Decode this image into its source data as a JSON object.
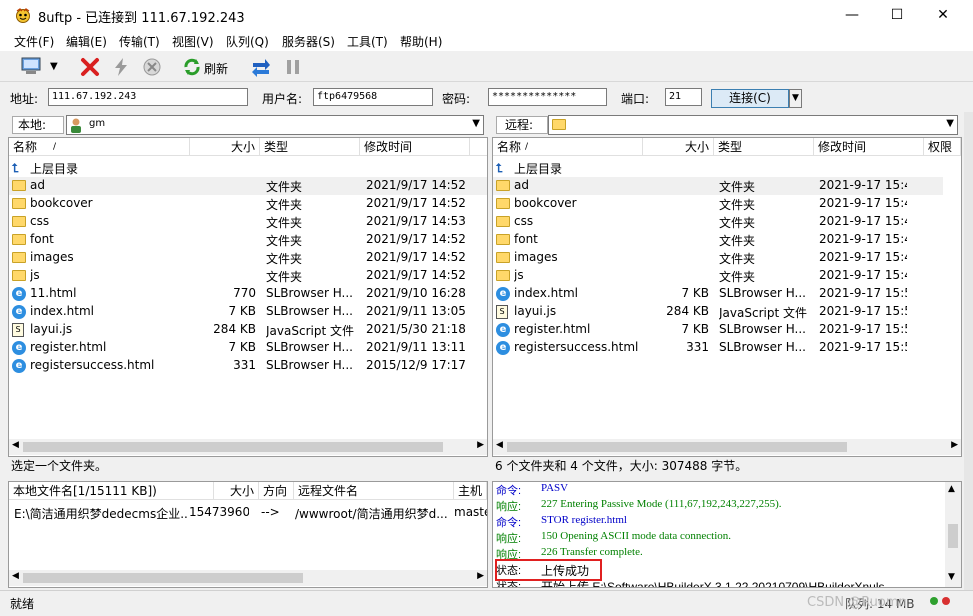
{
  "window": {
    "title": "8uftp - 已连接到 111.67.192.243",
    "minimize": "—",
    "maximize": "☐",
    "close": "✕"
  },
  "menu": [
    "文件(F)",
    "编辑(E)",
    "传输(T)",
    "视图(V)",
    "队列(Q)",
    "服务器(S)",
    "工具(T)",
    "帮助(H)"
  ],
  "toolbar": {
    "refresh_label": "刷新"
  },
  "connection": {
    "address_label": "地址:",
    "address_value": "111.67.192.243",
    "username_label": "用户名:",
    "username_value": "ftp6479568",
    "password_label": "密码:",
    "password_value": "**************",
    "port_label": "端口:",
    "port_value": "21",
    "connect_label": "连接(C)"
  },
  "local": {
    "path_label": "本地:",
    "path_value": "gm",
    "columns": [
      "名称",
      "大小",
      "类型",
      "修改时间"
    ],
    "parent_label": "上层目录",
    "files": [
      {
        "name": "ad",
        "size": "",
        "type": "文件夹",
        "mtime": "2021/9/17 14:52",
        "icon": "folder"
      },
      {
        "name": "bookcover",
        "size": "",
        "type": "文件夹",
        "mtime": "2021/9/17 14:52",
        "icon": "folder"
      },
      {
        "name": "css",
        "size": "",
        "type": "文件夹",
        "mtime": "2021/9/17 14:53",
        "icon": "folder"
      },
      {
        "name": "font",
        "size": "",
        "type": "文件夹",
        "mtime": "2021/9/17 14:52",
        "icon": "folder"
      },
      {
        "name": "images",
        "size": "",
        "type": "文件夹",
        "mtime": "2021/9/17 14:52",
        "icon": "folder"
      },
      {
        "name": "js",
        "size": "",
        "type": "文件夹",
        "mtime": "2021/9/17 14:52",
        "icon": "folder"
      },
      {
        "name": "11.html",
        "size": "770",
        "type": "SLBrowser H...",
        "mtime": "2021/9/10 16:28",
        "icon": "html"
      },
      {
        "name": "index.html",
        "size": "7 KB",
        "type": "SLBrowser H...",
        "mtime": "2021/9/11 13:05",
        "icon": "html"
      },
      {
        "name": "layui.js",
        "size": "284 KB",
        "type": "JavaScript 文件",
        "mtime": "2021/5/30 21:18",
        "icon": "js"
      },
      {
        "name": "register.html",
        "size": "7 KB",
        "type": "SLBrowser H...",
        "mtime": "2021/9/11 13:11",
        "icon": "html"
      },
      {
        "name": "registersuccess.html",
        "size": "331",
        "type": "SLBrowser H...",
        "mtime": "2015/12/9 17:17",
        "icon": "html"
      }
    ],
    "status": "选定一个文件夹。"
  },
  "remote": {
    "path_label": "远程:",
    "columns": [
      "名称",
      "大小",
      "类型",
      "修改时间",
      "权限"
    ],
    "parent_label": "上层目录",
    "files": [
      {
        "name": "ad",
        "size": "",
        "type": "文件夹",
        "mtime": "2021-9-17 15:4",
        "icon": "folder"
      },
      {
        "name": "bookcover",
        "size": "",
        "type": "文件夹",
        "mtime": "2021-9-17 15:4",
        "icon": "folder"
      },
      {
        "name": "css",
        "size": "",
        "type": "文件夹",
        "mtime": "2021-9-17 15:4",
        "icon": "folder"
      },
      {
        "name": "font",
        "size": "",
        "type": "文件夹",
        "mtime": "2021-9-17 15:4",
        "icon": "folder"
      },
      {
        "name": "images",
        "size": "",
        "type": "文件夹",
        "mtime": "2021-9-17 15:4",
        "icon": "folder"
      },
      {
        "name": "js",
        "size": "",
        "type": "文件夹",
        "mtime": "2021-9-17 15:4",
        "icon": "folder"
      },
      {
        "name": "index.html",
        "size": "7 KB",
        "type": "SLBrowser H...",
        "mtime": "2021-9-17 15:5",
        "icon": "html"
      },
      {
        "name": "layui.js",
        "size": "284 KB",
        "type": "JavaScript 文件",
        "mtime": "2021-9-17 15:5",
        "icon": "js"
      },
      {
        "name": "register.html",
        "size": "7 KB",
        "type": "SLBrowser H...",
        "mtime": "2021-9-17 15:5",
        "icon": "html"
      },
      {
        "name": "registersuccess.html",
        "size": "331",
        "type": "SLBrowser H...",
        "mtime": "2021-9-17 15:5",
        "icon": "html"
      }
    ],
    "status": "6 个文件夹和 4 个文件，大小: 307488 字节。"
  },
  "queue": {
    "columns": [
      "本地文件名[1/15111 KB])",
      "大小",
      "方向",
      "远程文件名",
      "主机"
    ],
    "row": {
      "local": "E:\\简洁通用织梦dedecms企业...",
      "size": "15473960",
      "direction": "-->",
      "remote": "/wwwroot/简洁通用织梦d...",
      "host": "maste"
    }
  },
  "log": [
    {
      "kind": "命令:",
      "text": "PASV",
      "color": "#0000c8"
    },
    {
      "kind": "响应:",
      "text": "227 Entering Passive Mode (111,67,192,243,227,255).",
      "color": "#008000"
    },
    {
      "kind": "命令:",
      "text": "STOR register.html",
      "color": "#0000c8"
    },
    {
      "kind": "响应:",
      "text": "150 Opening ASCII mode data connection.",
      "color": "#008000"
    },
    {
      "kind": "响应:",
      "text": "226 Transfer complete.",
      "color": "#008000"
    },
    {
      "kind": "状态:",
      "text": "上传成功",
      "color": "#000000"
    },
    {
      "kind": "状态:",
      "text": "开始上传 E:\\Software\\HBuilderX.3.1.22.20210709\\HBuilderXnuls",
      "color": "#000000"
    }
  ],
  "statusbar": {
    "left": "就绪",
    "right": "队列: 14 MB",
    "watermark": "CSDN @Ruomn"
  },
  "colors": {
    "highlight_box": "#e02020",
    "command": "#0000c8",
    "response": "#008000"
  }
}
